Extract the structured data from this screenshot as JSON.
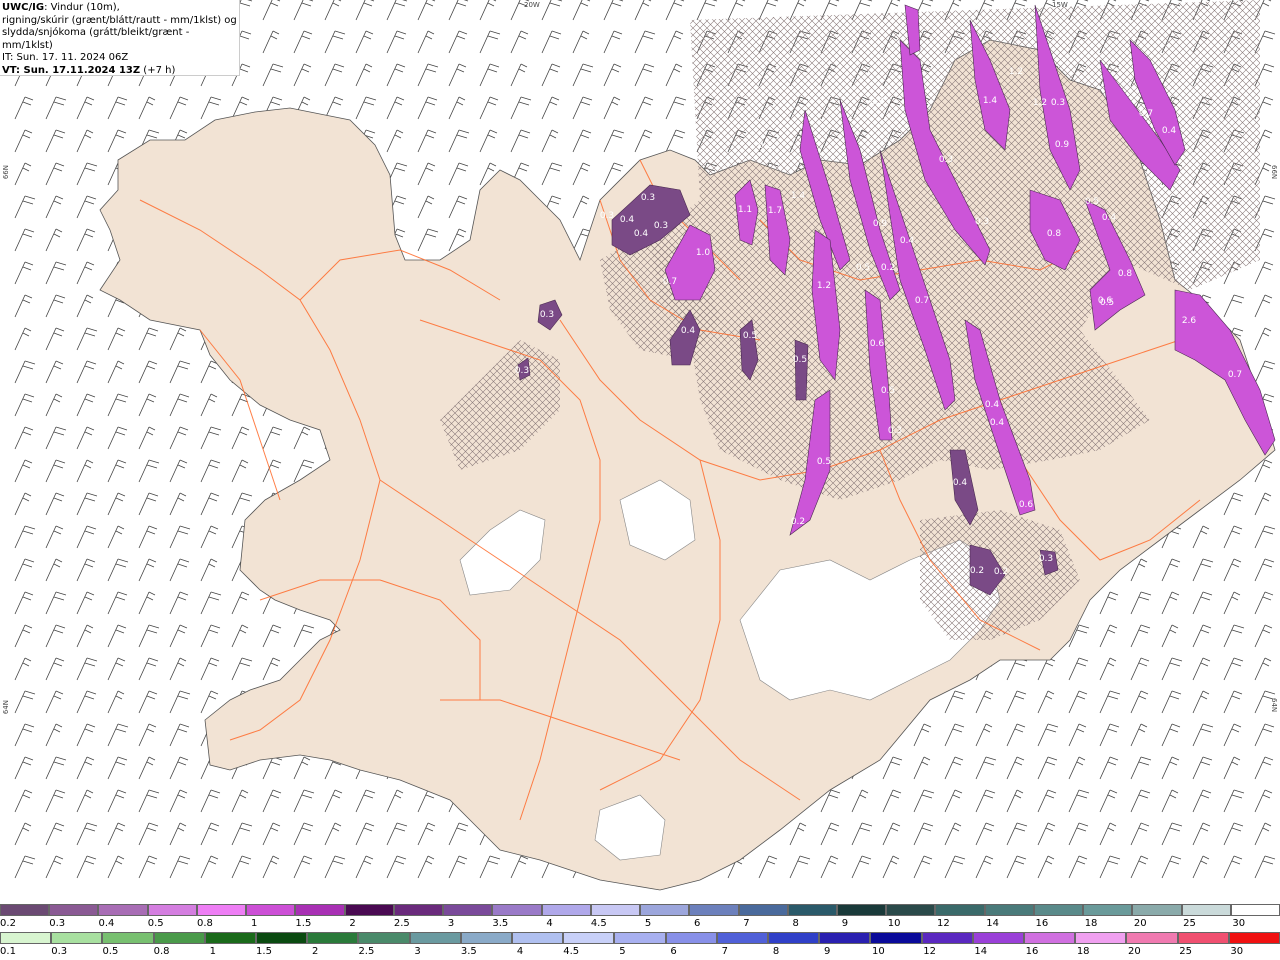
{
  "info": {
    "line1_bold": "UWC/IG",
    "line1_rest": ": Vindur (10m),",
    "line2": "rigning/skúrir (grænt/blátt/rautt - mm/1klst) og",
    "line3": "slydda/snjókoma (grátt/bleikt/grænt - mm/1klst)",
    "line4": "IT: Sun. 17. 11. 2024 06Z",
    "line5_bold": "VT: Sun. 17.11.2024 13Z",
    "line5_rest": " (+7 h)"
  },
  "coords": {
    "top_mid": "20W",
    "top_right": "15W",
    "left_upper": "66N",
    "right_upper": "66N",
    "left_lower": "64N",
    "right_lower": "64N"
  },
  "precip_labels": [
    "0.3",
    "0.4",
    "0.3",
    "0.4",
    "0.3",
    "0.3",
    "0.3",
    "1.0",
    "0.7",
    "0.4",
    "1.1",
    "1.7",
    "0.5",
    "1.4",
    "0.2",
    "0.5",
    "0.5",
    "0.2",
    "1.2",
    "0.9",
    "0.5",
    "0.2",
    "0.4",
    "0.6",
    "0.7",
    "0.5",
    "0.3",
    "0.3",
    "0.9",
    "0.4",
    "0.4",
    "0.6",
    "0.4",
    "0.2",
    "0.2",
    "0.3",
    "1.2",
    "0.8",
    "1.4",
    "1.2",
    "0.9",
    "0.3",
    "0.5",
    "0.4",
    "0.8",
    "0.6",
    "0.5",
    "0.7",
    "0.4",
    "2.6",
    "0.7",
    "0.3"
  ],
  "legend_top": {
    "labels": [
      "0.2",
      "0.3",
      "0.4",
      "0.5",
      "0.8",
      "1",
      "1.5",
      "2",
      "2.5",
      "3",
      "3.5",
      "4",
      "4.5",
      "5",
      "6",
      "7",
      "8",
      "9",
      "10",
      "12",
      "14",
      "16",
      "18",
      "20",
      "25",
      "30"
    ],
    "colors": [
      "#6b4a73",
      "#8a5a94",
      "#a86db5",
      "#d47ee0",
      "#ee7ef5",
      "#cc4fd6",
      "#a830b4",
      "#4a0a52",
      "#6a2a7c",
      "#7a4a9a",
      "#9a7ac8",
      "#b0a8ea",
      "#c8c8f4",
      "#9ca6dc",
      "#6c80bc",
      "#4a6a9c",
      "#2a5a6a",
      "#1a3a3a",
      "#2a4a4a",
      "#3a6a6a",
      "#4a7a7a",
      "#5a8a8a",
      "#6a9a9a",
      "#8aaaaa",
      "#cadada",
      "#ffffff"
    ]
  },
  "legend_bottom": {
    "labels": [
      "0.1",
      "0.3",
      "0.5",
      "0.8",
      "1",
      "1.5",
      "2",
      "2.5",
      "3",
      "3.5",
      "4",
      "4.5",
      "5",
      "6",
      "7",
      "8",
      "9",
      "10",
      "12",
      "14",
      "16",
      "18",
      "20",
      "25",
      "30"
    ],
    "colors": [
      "#d8f5d0",
      "#a8e0a0",
      "#78c070",
      "#4a9a4a",
      "#1a6a1a",
      "#0a4a10",
      "#2a7a3a",
      "#4a8a6a",
      "#6a9aa0",
      "#8aaac8",
      "#b0c0f0",
      "#c8d0f8",
      "#a8b0f0",
      "#8890e8",
      "#5060d8",
      "#3040c8",
      "#2a20b0",
      "#0a0a9a",
      "#5a28c0",
      "#9a40d8",
      "#d070e0",
      "#f0a0f0",
      "#f07ab0",
      "#f05070",
      "#f01010"
    ]
  },
  "colors": {
    "land": "#f2e3d4",
    "roads": "#ff6a2a",
    "coast": "#555555",
    "wind": "#444444"
  }
}
